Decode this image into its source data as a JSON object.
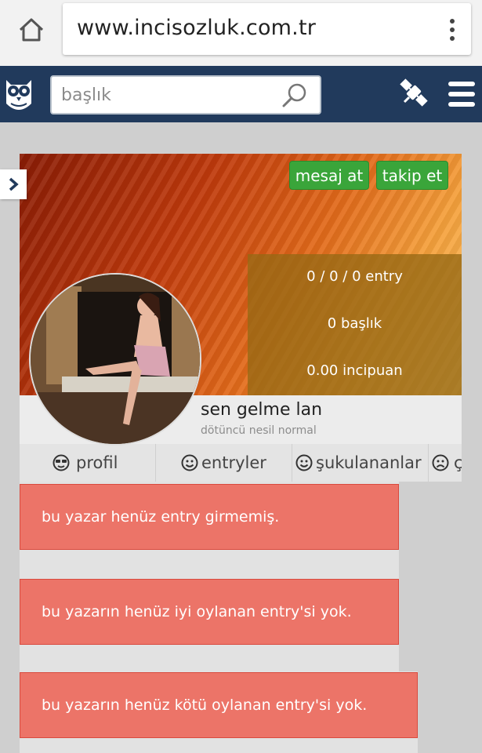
{
  "browser": {
    "url": "www.incisozluk.com.tr"
  },
  "header": {
    "search_placeholder": "başlık"
  },
  "profile": {
    "actions": {
      "message_label": "mesaj at",
      "follow_label": "takip et"
    },
    "stats": {
      "entries": "0 / 0 / 0 entry",
      "titles": "0 başlık",
      "points": "0.00 incipuan"
    },
    "username": "sen gelme lan",
    "user_title": "dötüncü nesil normal",
    "tabs": [
      {
        "label": "profil",
        "icon": "cool-face-icon"
      },
      {
        "label": "entryler",
        "icon": "smile-icon"
      },
      {
        "label": "şukulananlar",
        "icon": "smile-icon"
      },
      {
        "label": "ç",
        "icon": "frown-icon"
      }
    ]
  },
  "messages": [
    "bu yazar henüz entry girmemiş.",
    "bu yazarın henüz iyi oylanan entry'si yok.",
    "bu yazarın henüz kötü oylanan entry'si yok."
  ],
  "colors": {
    "header_bg": "#213a5c",
    "button_green": "#3aa53a",
    "alert_bg": "#ec7468"
  }
}
